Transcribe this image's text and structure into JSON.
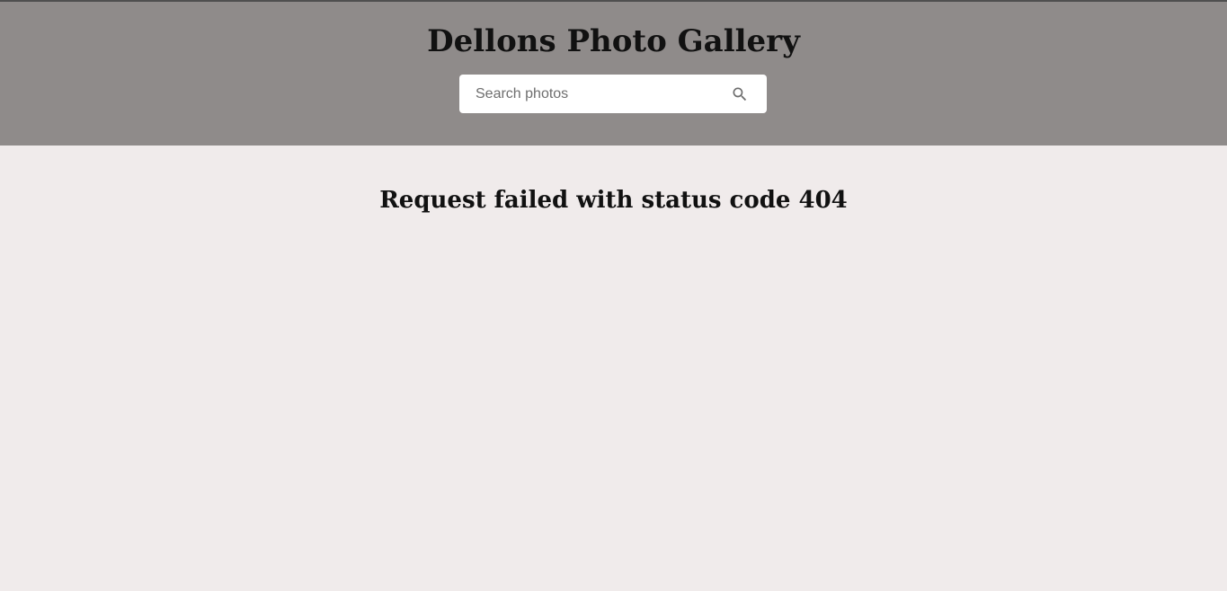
{
  "header": {
    "title": "Dellons Photo Gallery",
    "background_color": "#8f8b8a"
  },
  "search": {
    "placeholder": "Search photos",
    "value": "",
    "icon": "search-icon"
  },
  "main": {
    "error_message": "Request failed with status code 404",
    "background_color": "#f0ebeb"
  }
}
